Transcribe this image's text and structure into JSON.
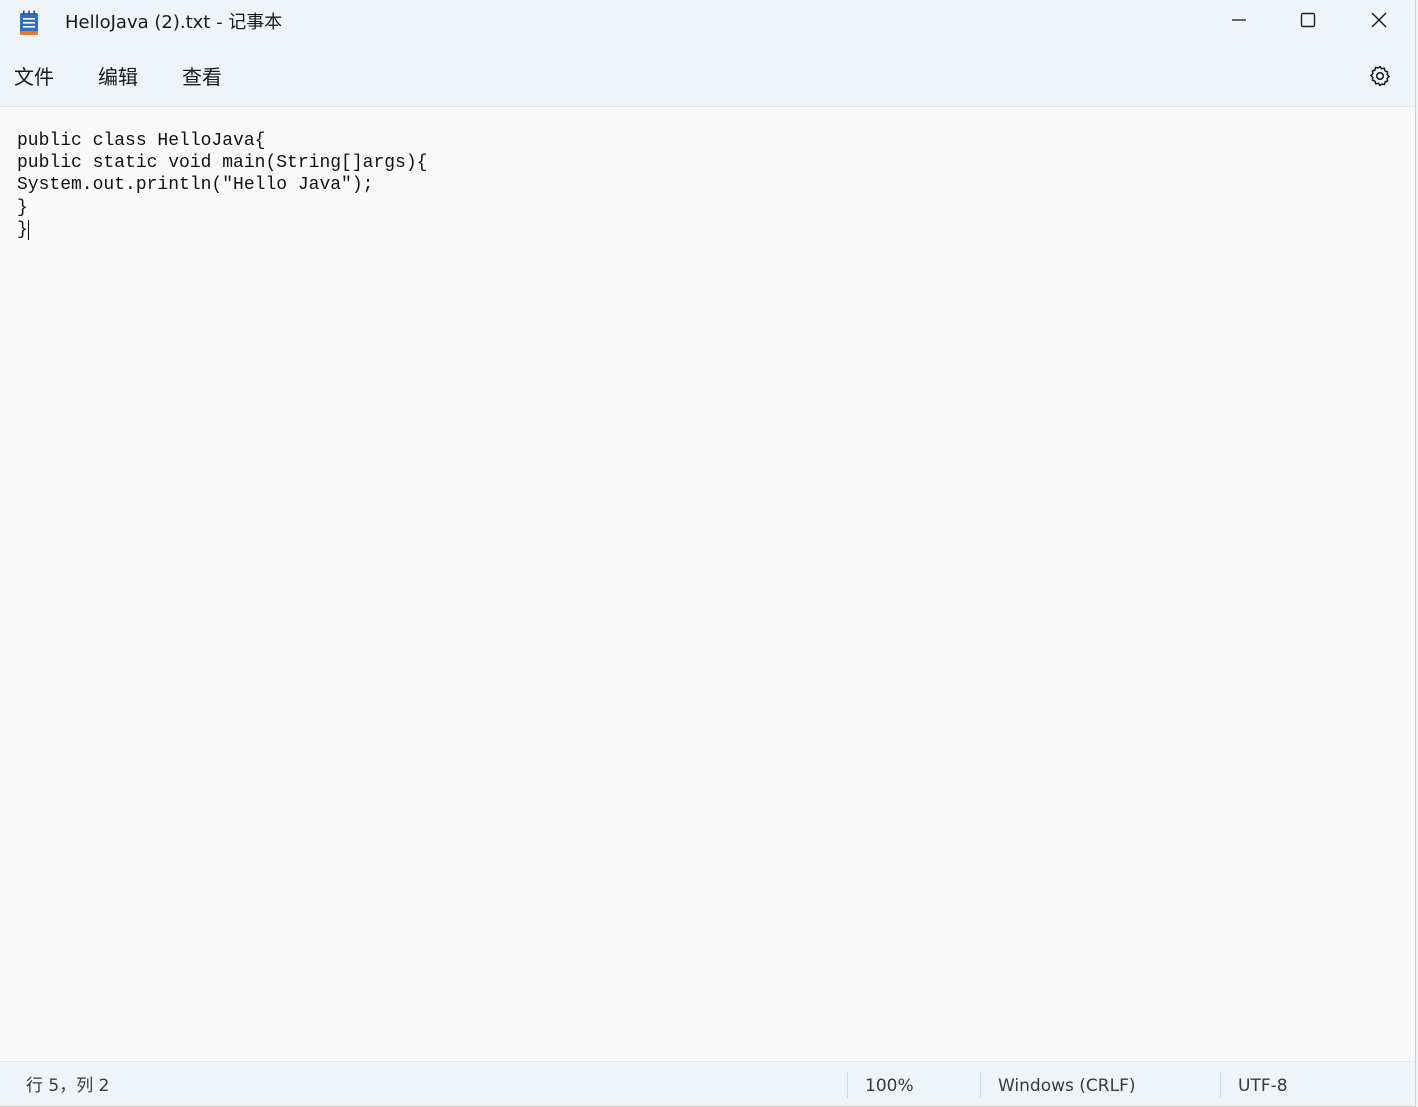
{
  "window": {
    "title": "HelloJava (2).txt - 记事本"
  },
  "icons": {
    "app": "notepad-icon",
    "minimize": "minimize-icon",
    "maximize": "maximize-icon",
    "close": "close-icon",
    "settings": "gear-icon"
  },
  "menu": {
    "file": "文件",
    "edit": "编辑",
    "view": "查看"
  },
  "editor": {
    "content": "public class HelloJava{\npublic static void main(String[]args){\nSystem.out.println(\"Hello Java\");\n}\n}"
  },
  "status": {
    "position": "行 5，列 2",
    "zoom": "100%",
    "line_ending": "Windows (CRLF)",
    "encoding": "UTF-8"
  },
  "colors": {
    "chrome": "#eff4f9",
    "editor_bg": "#f9f9f9",
    "icon_blue": "#2f6fc4",
    "icon_orange": "#e07a2f"
  }
}
